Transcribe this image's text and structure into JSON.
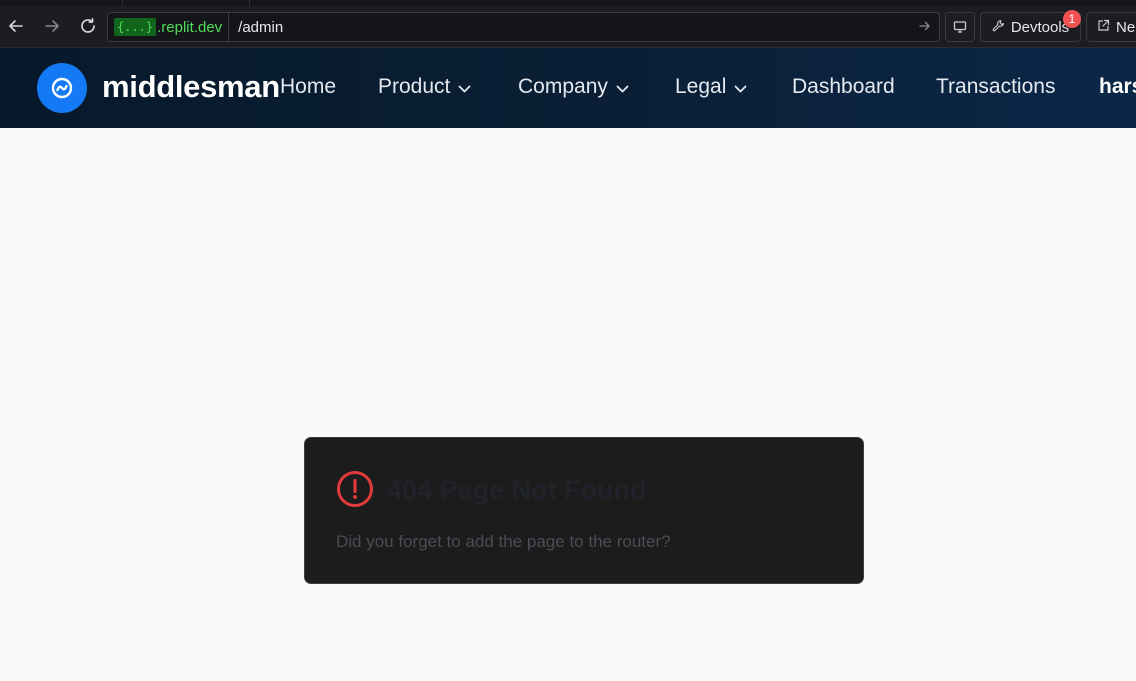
{
  "browser": {
    "url_badge": "{...}",
    "url_host": ".replit.dev",
    "url_path": "/admin",
    "devtools_label": "Devtools",
    "devtools_count": "1",
    "new_tab_label": "Ne",
    "icons": [
      "back-arrow-icon",
      "forward-arrow-icon",
      "reload-icon",
      "go-arrow-icon",
      "screen-icon",
      "wrench-icon",
      "external-link-icon"
    ]
  },
  "header": {
    "brand": "middlesman",
    "nav": {
      "home": "Home",
      "product": "Product",
      "company": "Company",
      "legal": "Legal",
      "dashboard": "Dashboard",
      "transactions": "Transactions",
      "user": "hars"
    }
  },
  "error": {
    "title": "404 Page Not Found",
    "description": "Did you forget to add the page to the router?"
  },
  "colors": {
    "brand_blue": "#1479f5",
    "header_dark": "#07192b",
    "error_red": "#e03a3a",
    "page_bg": "#f8f9fb",
    "card_bg": "#1c1c1c",
    "url_green": "#4fdc5a"
  }
}
